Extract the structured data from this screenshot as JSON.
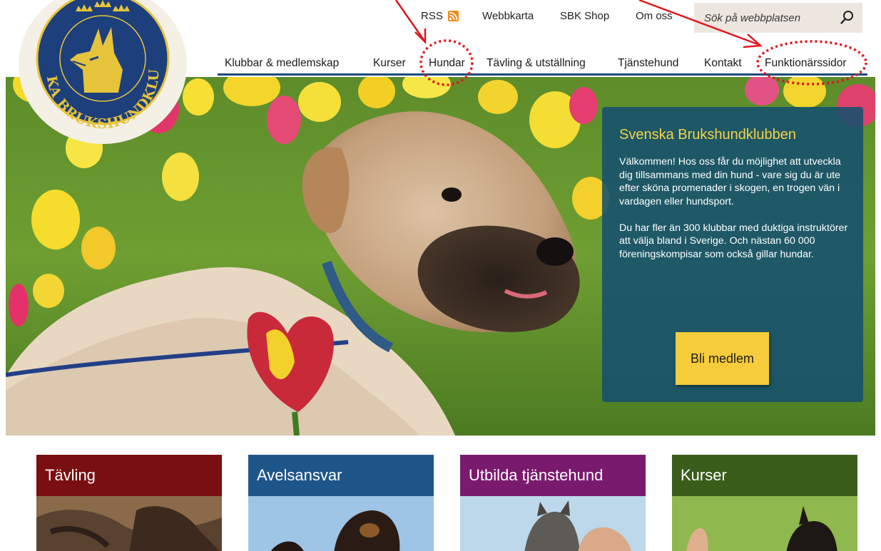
{
  "top_links": {
    "rss": "RSS",
    "sitemap": "Webbkarta",
    "shop": "SBK Shop",
    "about": "Om oss"
  },
  "search": {
    "placeholder": "Sök på webbplatsen"
  },
  "logo": {
    "text": "SVENSKA BRUKSHUNDKLUBBEN"
  },
  "main_nav": {
    "items": [
      {
        "label": "Klubbar & medlemskap"
      },
      {
        "label": "Kurser"
      },
      {
        "label": "Hundar"
      },
      {
        "label": "Tävling & utställning"
      },
      {
        "label": "Tjänstehund"
      },
      {
        "label": "Kontakt"
      },
      {
        "label": "Funktionärssidor"
      }
    ]
  },
  "info_box": {
    "title": "Svenska Brukshundklubben",
    "paragraph_1": "Välkommen! Hos oss får du möjlighet att utveckla dig tillsammans med din hund - vare sig du är ute efter sköna promenader i skogen, en trogen vän i vardagen eller hundsport.",
    "paragraph_2": "Du har fler än 300 klubbar med duktiga instruktörer att välja bland i Sverige. Och nästan 60 000 föreningskompisar som också gillar hundar.",
    "button_label": "Bli medlem"
  },
  "cards": [
    {
      "title": "Tävling",
      "color": "#7a0f12"
    },
    {
      "title": "Avelsansvar",
      "color": "#1f5689"
    },
    {
      "title": "Utbilda tjänstehund",
      "color": "#7a1a6e"
    },
    {
      "title": "Kurser",
      "color": "#3a5d1b"
    }
  ],
  "colors": {
    "nav_underline": "#1d4a78",
    "info_box_bg": "#14506e",
    "info_title": "#f4d347",
    "join_button": "#f6cc3c",
    "search_bg": "#ede6df",
    "annotation_red": "#e0161e"
  },
  "icons": {
    "rss": "rss-icon",
    "search": "search-icon"
  }
}
